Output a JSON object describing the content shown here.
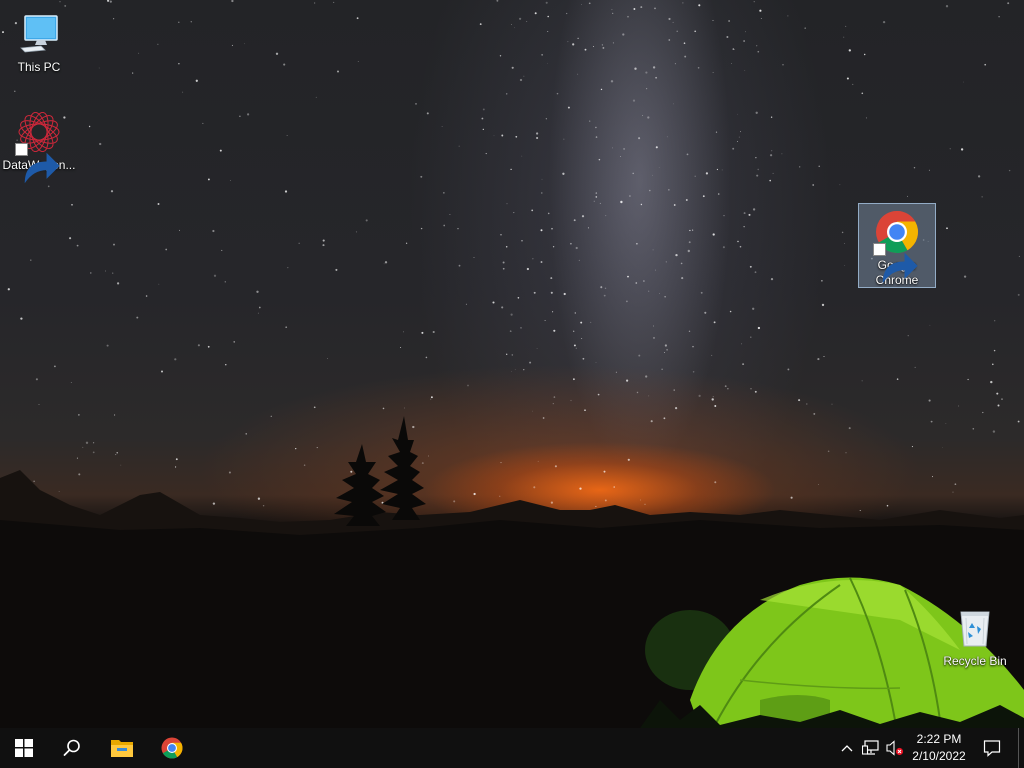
{
  "desktop": {
    "icons": [
      {
        "label": "This PC",
        "icon": "this-pc-icon"
      },
      {
        "label": "DataWagon...",
        "icon": "datawagon-icon"
      },
      {
        "label": "Google\nChrome",
        "icon": "chrome-icon",
        "selected": true
      },
      {
        "label": "Recycle Bin",
        "icon": "recycle-bin-icon"
      }
    ]
  },
  "taskbar": {
    "start": "windows-start-icon",
    "search": "search-icon",
    "pinned": [
      "file-explorer-icon",
      "chrome-icon"
    ],
    "tray": [
      "chevron-up-icon",
      "network-icon",
      "volume-muted-icon"
    ],
    "time": "2:22 PM",
    "date": "2/10/2022",
    "notifications": "action-center-icon"
  },
  "colors": {
    "taskbar": "#101010",
    "tent": "#8fd41e",
    "horizon_glow": "#ff6e14"
  }
}
